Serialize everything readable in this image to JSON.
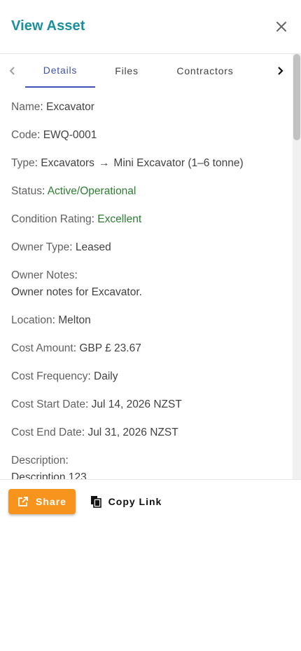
{
  "dialog": {
    "title": "View Asset"
  },
  "tabs": {
    "items": [
      {
        "label": "Details"
      },
      {
        "label": "Files"
      },
      {
        "label": "Contractors"
      }
    ]
  },
  "details": {
    "name": {
      "label": "Name",
      "value": "Excavator"
    },
    "code": {
      "label": "Code",
      "value": "EWQ-0001"
    },
    "type": {
      "label": "Type",
      "category": "Excavators",
      "arrow": "→",
      "subcategory": "Mini Excavator (1–6 tonne)"
    },
    "status": {
      "label": "Status",
      "value": "Active/Operational",
      "color": "#2e7d32"
    },
    "condition": {
      "label": "Condition Rating",
      "value": "Excellent",
      "color": "#2e7d32"
    },
    "owner_type": {
      "label": "Owner Type",
      "value": "Leased"
    },
    "owner_notes": {
      "label": "Owner Notes",
      "value": "Owner notes for Excavator."
    },
    "location": {
      "label": "Location",
      "value": "Melton"
    },
    "cost_amount": {
      "label": "Cost Amount",
      "value": "GBP £ 23.67"
    },
    "cost_frequency": {
      "label": "Cost Frequency",
      "value": "Daily"
    },
    "cost_start": {
      "label": "Cost Start Date",
      "value": "Jul 14, 2026 NZST"
    },
    "cost_end": {
      "label": "Cost End Date",
      "value": "Jul 31, 2026 NZST"
    },
    "description": {
      "label": "Description",
      "value": "Description 123"
    }
  },
  "actions": {
    "share_label": "Share",
    "copy_label": "Copy Link"
  },
  "colors": {
    "title": "#1a8fa0",
    "tab_active": "#3f51b5",
    "share_button": "#f7941d"
  },
  "icons": {
    "close": "close-icon",
    "prev": "chevron-left-icon",
    "next": "chevron-right-icon",
    "share": "open-in-new-icon",
    "copy": "copy-icon"
  }
}
